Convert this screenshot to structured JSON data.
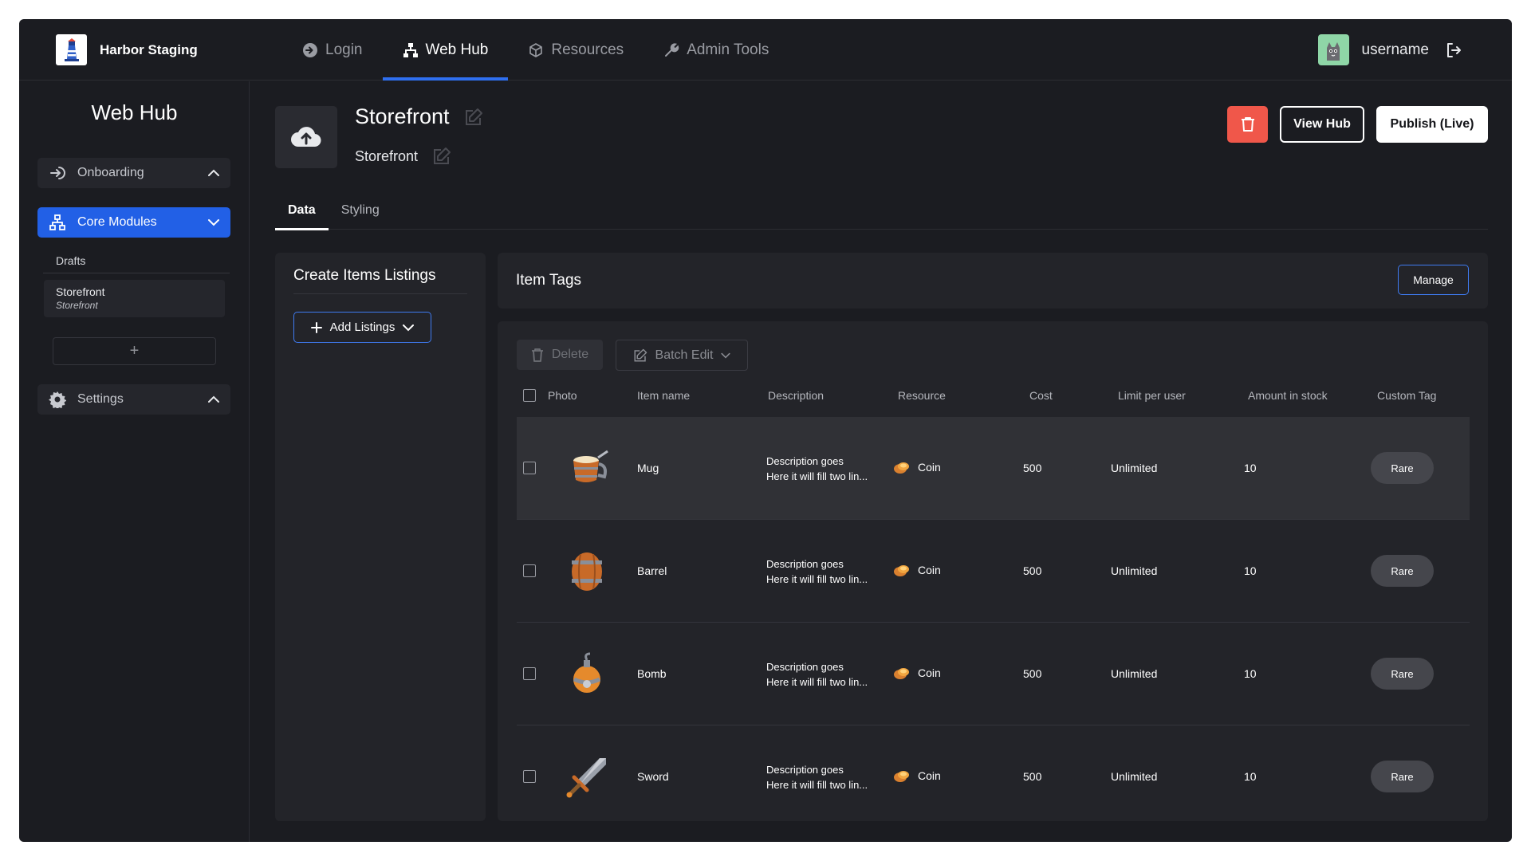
{
  "app": {
    "brand": "Harbor Staging"
  },
  "nav": {
    "items": [
      {
        "label": "Login",
        "icon": "login-arrow-icon"
      },
      {
        "label": "Web Hub",
        "icon": "sitemap-icon"
      },
      {
        "label": "Resources",
        "icon": "cube-icon"
      },
      {
        "label": "Admin Tools",
        "icon": "wrench-icon"
      }
    ],
    "active": "Web Hub"
  },
  "user": {
    "name": "username"
  },
  "sidebar": {
    "title": "Web Hub",
    "groups": [
      {
        "label": "Onboarding"
      },
      {
        "label": "Core Modules"
      },
      {
        "label": "Settings"
      }
    ],
    "drafts_label": "Drafts",
    "card": {
      "title": "Storefront",
      "subtitle": "Storefront"
    },
    "add_label": "+"
  },
  "header": {
    "title": "Storefront",
    "subtitle": "Storefront",
    "view_label": "View Hub",
    "publish_label": "Publish (Live)"
  },
  "tabs": [
    {
      "label": "Data"
    },
    {
      "label": "Styling"
    }
  ],
  "left_panel": {
    "title": "Create Items Listings",
    "add_label": "Add Listings"
  },
  "tags_panel": {
    "title": "Item Tags",
    "manage_label": "Manage"
  },
  "toolbar": {
    "delete_label": "Delete",
    "batch_label": "Batch Edit"
  },
  "table": {
    "columns": [
      "Photo",
      "Item name",
      "Description",
      "Resource",
      "Cost",
      "Limit per user",
      "Amount in stock",
      "Custom Tag"
    ],
    "rows": [
      {
        "name": "Mug",
        "desc1": "Description goes",
        "desc2": "Here it will fill two lin...",
        "resource": "Coin",
        "cost": "500",
        "limit": "Unlimited",
        "stock": "10",
        "tag": "Rare"
      },
      {
        "name": "Barrel",
        "desc1": "Description goes",
        "desc2": "Here it will fill two lin...",
        "resource": "Coin",
        "cost": "500",
        "limit": "Unlimited",
        "stock": "10",
        "tag": "Rare"
      },
      {
        "name": "Bomb",
        "desc1": "Description goes",
        "desc2": "Here it will fill two lin...",
        "resource": "Coin",
        "cost": "500",
        "limit": "Unlimited",
        "stock": "10",
        "tag": "Rare"
      },
      {
        "name": "Sword",
        "desc1": "Description goes",
        "desc2": "Here it will fill two lin...",
        "resource": "Coin",
        "cost": "500",
        "limit": "Unlimited",
        "stock": "10",
        "tag": "Rare"
      }
    ]
  },
  "colors": {
    "accent": "#2260e6",
    "danger": "#f0574a",
    "background": "#1b1c21",
    "panel": "#232429"
  }
}
